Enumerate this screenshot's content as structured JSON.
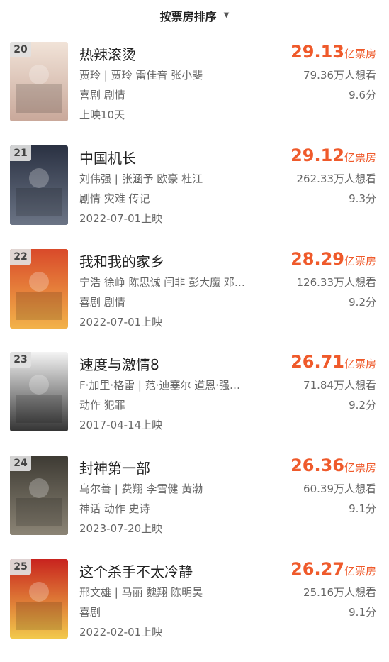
{
  "header": {
    "sort_label": "按票房排序",
    "caret": "▼"
  },
  "movies": [
    {
      "rank": "20",
      "title": "热辣滚烫",
      "cast": "贾玲 | 贾玲 雷佳音 张小斐",
      "genre": "喜剧 剧情",
      "date": "上映10天",
      "box_office": "29.13",
      "box_unit": "亿票房",
      "want": "79.36万人想看",
      "score": "9.6分",
      "poster_colors": [
        "#f1e3d8",
        "#c9a89a"
      ]
    },
    {
      "rank": "21",
      "title": "中国机长",
      "cast": "刘伟强 | 张涵予 欧豪 杜江",
      "genre": "剧情 灾难 传记",
      "date": "2022-07-01上映",
      "box_office": "29.12",
      "box_unit": "亿票房",
      "want": "262.33万人想看",
      "score": "9.3分",
      "poster_colors": [
        "#2a3142",
        "#6b7485"
      ]
    },
    {
      "rank": "22",
      "title": "我和我的家乡",
      "cast": "宁浩 徐峥 陈思诚 闫非 彭大魔 邓…",
      "genre": "喜剧 剧情",
      "date": "2022-07-01上映",
      "box_office": "28.29",
      "box_unit": "亿票房",
      "want": "126.33万人想看",
      "score": "9.2分",
      "poster_colors": [
        "#d94a2a",
        "#f2b24a"
      ]
    },
    {
      "rank": "23",
      "title": "速度与激情8",
      "cast": "F·加里·格雷 | 范·迪塞尔 道恩·强…",
      "genre": "动作 犯罪",
      "date": "2017-04-14上映",
      "box_office": "26.71",
      "box_unit": "亿票房",
      "want": "71.84万人想看",
      "score": "9.2分",
      "poster_colors": [
        "#f4f4f4",
        "#333333"
      ]
    },
    {
      "rank": "24",
      "title": "封神第一部",
      "cast": "乌尔善 | 费翔 李雪健 黄渤",
      "genre": "神话 动作 史诗",
      "date": "2023-07-20上映",
      "box_office": "26.36",
      "box_unit": "亿票房",
      "want": "60.39万人想看",
      "score": "9.1分",
      "poster_colors": [
        "#3d3a33",
        "#8b8475"
      ]
    },
    {
      "rank": "25",
      "title": "这个杀手不太冷静",
      "cast": "邢文雄 | 马丽 魏翔 陈明昊",
      "genre": "喜剧",
      "date": "2022-02-01上映",
      "box_office": "26.27",
      "box_unit": "亿票房",
      "want": "25.16万人想看",
      "score": "9.1分",
      "poster_colors": [
        "#c8231e",
        "#f2c94c"
      ]
    }
  ]
}
